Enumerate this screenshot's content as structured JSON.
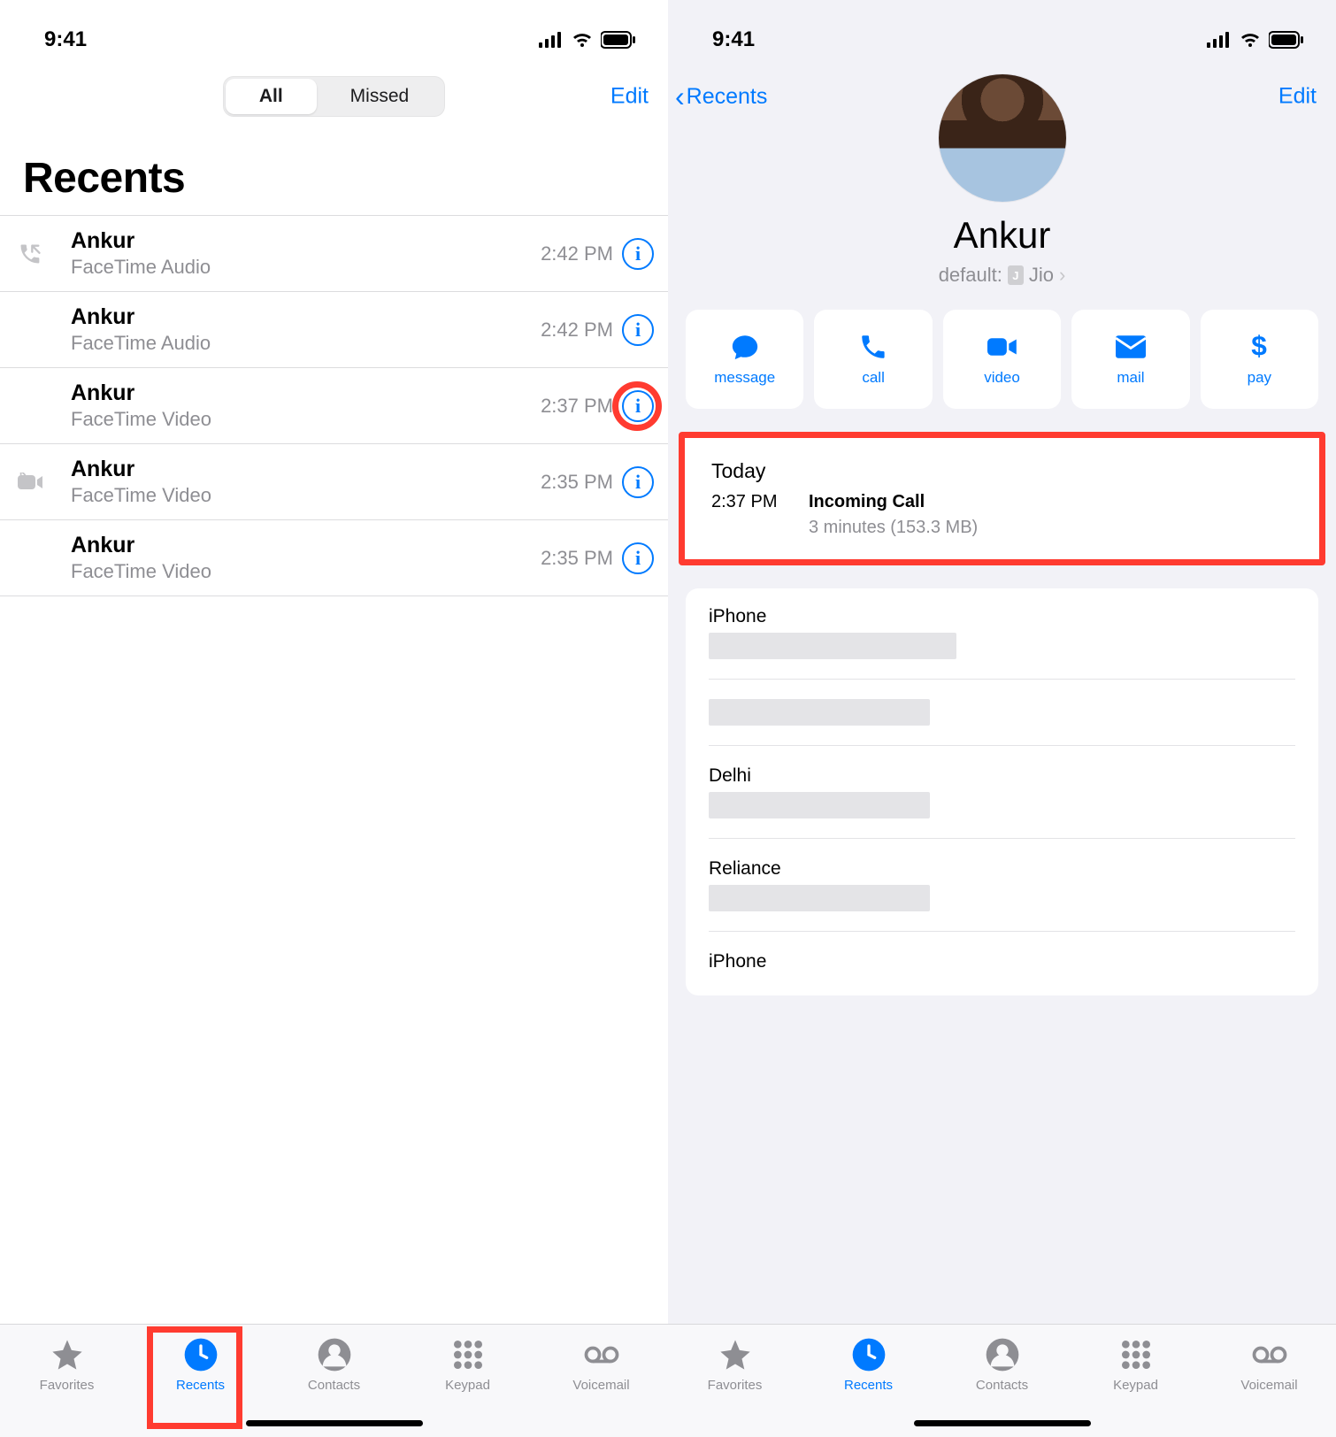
{
  "left": {
    "status_time": "9:41",
    "seg_all": "All",
    "seg_missed": "Missed",
    "edit": "Edit",
    "title": "Recents",
    "rows": [
      {
        "name": "Ankur",
        "sub": "FaceTime Audio",
        "time": "2:42 PM",
        "leading": "outgoing"
      },
      {
        "name": "Ankur",
        "sub": "FaceTime Audio",
        "time": "2:42 PM",
        "leading": ""
      },
      {
        "name": "Ankur",
        "sub": "FaceTime Video",
        "time": "2:37 PM",
        "leading": ""
      },
      {
        "name": "Ankur",
        "sub": "FaceTime Video",
        "time": "2:35 PM",
        "leading": "outgoing-video"
      },
      {
        "name": "Ankur",
        "sub": "FaceTime Video",
        "time": "2:35 PM",
        "leading": ""
      }
    ],
    "tabs": {
      "favorites": "Favorites",
      "recents": "Recents",
      "contacts": "Contacts",
      "keypad": "Keypad",
      "voicemail": "Voicemail"
    }
  },
  "right": {
    "status_time": "9:41",
    "back": "Recents",
    "edit": "Edit",
    "name": "Ankur",
    "default_label": "default:",
    "default_sim": "Jio",
    "sim_badge": "J",
    "actions": {
      "message": "message",
      "call": "call",
      "video": "video",
      "mail": "mail",
      "pay": "pay"
    },
    "today": {
      "heading": "Today",
      "time": "2:37 PM",
      "title": "Incoming Call",
      "detail": "3 minutes (153.3 MB)"
    },
    "fields": [
      {
        "label": "iPhone"
      },
      {
        "label": ""
      },
      {
        "label": "Delhi"
      },
      {
        "label": "Reliance"
      },
      {
        "label": "iPhone"
      }
    ],
    "tabs": {
      "favorites": "Favorites",
      "recents": "Recents",
      "contacts": "Contacts",
      "keypad": "Keypad",
      "voicemail": "Voicemail"
    }
  }
}
